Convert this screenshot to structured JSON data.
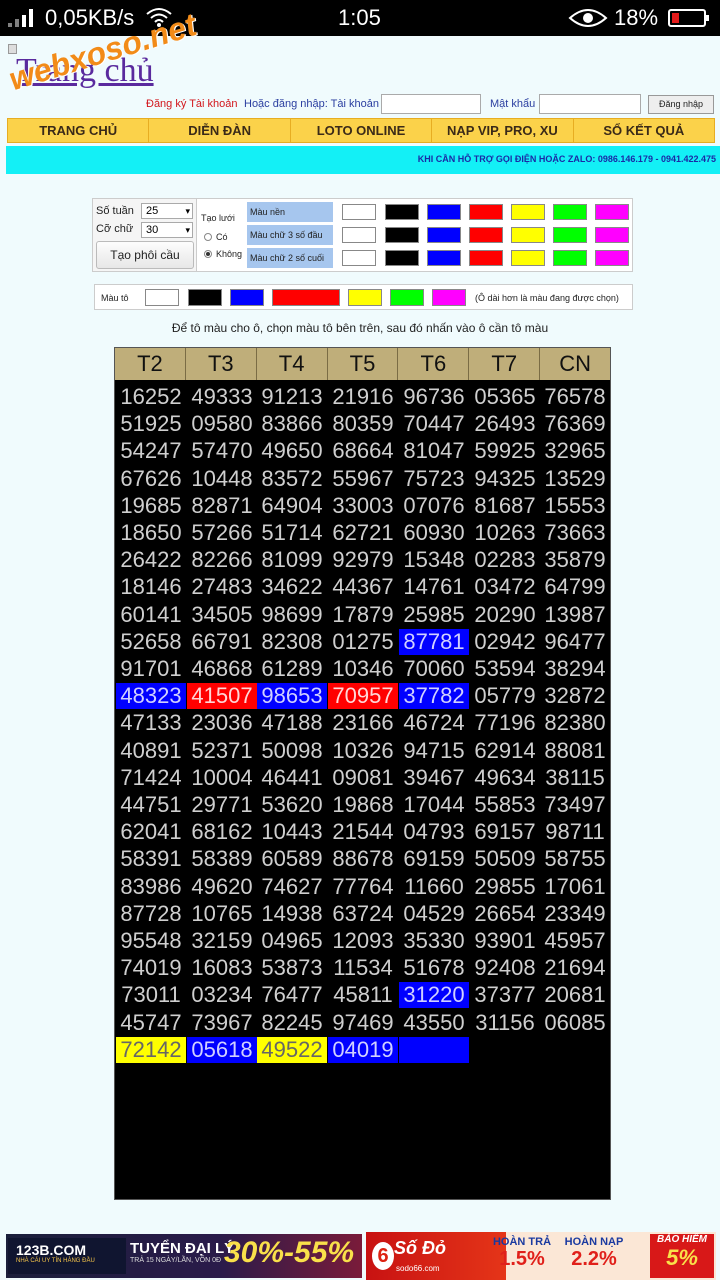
{
  "status_bar": {
    "speed": "0,05KB/s",
    "time": "1:05",
    "battery": "18%"
  },
  "header": {
    "logo_link": "Trang chủ",
    "watermark": "webxoso.net",
    "register": "Đăng ký Tài khoản",
    "login_label": "Hoặc đăng nhập: Tài khoản",
    "password_label": "Mật khẩu",
    "login_button": "Đăng nhập"
  },
  "nav": [
    "TRANG CHỦ",
    "DIỄN ĐÀN",
    "LOTO ONLINE",
    "NẠP VIP, PRO, XU",
    "SỔ KẾT QUẢ"
  ],
  "hotline": "KHI CẦN HỖ TRỢ GỌI ĐIỆN HOẶC ZALO: 0986.146.179 - 0941.422.475",
  "tool": {
    "weeks_label": "Số tuần",
    "weeks_value": "25",
    "font_label": "Cỡ chữ",
    "font_value": "30",
    "create_button": "Tạo phôi cầu",
    "grid_label": "Tạo lưới",
    "opt_yes": "Có",
    "opt_no": "Không",
    "row_labels": [
      "Màu nền",
      "Màu chữ 3 số đầu",
      "Màu chữ 2 số cuối"
    ],
    "palette": [
      "#ffffff",
      "#000000",
      "#0000ff",
      "#ff0000",
      "#ffff00",
      "#00ff00",
      "#ff00ff"
    ],
    "paint_label": "Màu tô",
    "paint_note": "(Ô dài hơn là màu đang được chọn)"
  },
  "instruction": "Để tô màu cho ô, chọn màu tô bên trên, sau đó nhấn vào ô cần tô màu",
  "grid": {
    "headers": [
      "T2",
      "T3",
      "T4",
      "T5",
      "T6",
      "T7",
      "CN"
    ],
    "rows": [
      [
        "16252",
        "49333",
        "91213",
        "21916",
        "96736",
        "05365",
        "76578"
      ],
      [
        "51925",
        "09580",
        "83866",
        "80359",
        "70447",
        "26493",
        "76369"
      ],
      [
        "54247",
        "57470",
        "49650",
        "68664",
        "81047",
        "59925",
        "32965"
      ],
      [
        "67626",
        "10448",
        "83572",
        "55967",
        "75723",
        "94325",
        "13529"
      ],
      [
        "19685",
        "82871",
        "64904",
        "33003",
        "07076",
        "81687",
        "15553"
      ],
      [
        "18650",
        "57266",
        "51714",
        "62721",
        "60930",
        "10263",
        "73663"
      ],
      [
        "26422",
        "82266",
        "81099",
        "92979",
        "15348",
        "02283",
        "35879"
      ],
      [
        "18146",
        "27483",
        "34622",
        "44367",
        "14761",
        "03472",
        "64799"
      ],
      [
        "60141",
        "34505",
        "98699",
        "17879",
        "25985",
        "20290",
        "13987"
      ],
      [
        "52658",
        "66791",
        "82308",
        "01275",
        "87781",
        "02942",
        "96477"
      ],
      [
        "91701",
        "46868",
        "61289",
        "10346",
        "70060",
        "53594",
        "38294"
      ],
      [
        "48323",
        "41507",
        "98653",
        "70957",
        "37782",
        "05779",
        "32872"
      ],
      [
        "47133",
        "23036",
        "47188",
        "23166",
        "46724",
        "77196",
        "82380"
      ],
      [
        "40891",
        "52371",
        "50098",
        "10326",
        "94715",
        "62914",
        "88081"
      ],
      [
        "71424",
        "10004",
        "46441",
        "09081",
        "39467",
        "49634",
        "38115"
      ],
      [
        "44751",
        "29771",
        "53620",
        "19868",
        "17044",
        "55853",
        "73497"
      ],
      [
        "62041",
        "68162",
        "10443",
        "21544",
        "04793",
        "69157",
        "98711"
      ],
      [
        "58391",
        "58389",
        "60589",
        "88678",
        "69159",
        "50509",
        "58755"
      ],
      [
        "83986",
        "49620",
        "74627",
        "77764",
        "11660",
        "29855",
        "17061"
      ],
      [
        "87728",
        "10765",
        "14938",
        "63724",
        "04529",
        "26654",
        "23349"
      ],
      [
        "95548",
        "32159",
        "04965",
        "12093",
        "35330",
        "93901",
        "45957"
      ],
      [
        "74019",
        "16083",
        "53873",
        "11534",
        "51678",
        "92408",
        "21694"
      ],
      [
        "73011",
        "03234",
        "76477",
        "45811",
        "31220",
        "37377",
        "20681"
      ],
      [
        "45747",
        "73967",
        "82245",
        "97469",
        "43550",
        "31156",
        "06085"
      ],
      [
        "72142",
        "05618",
        "49522",
        "04019",
        "",
        "",
        ""
      ]
    ],
    "highlights": [
      {
        "row": 9,
        "col": 4,
        "bg": "#0000ff",
        "fg": "#d0d0ff"
      },
      {
        "row": 11,
        "col": 0,
        "bg": "#0000ff",
        "fg": "#d0d0ff"
      },
      {
        "row": 11,
        "col": 1,
        "bg": "#ff0000",
        "fg": "#ffd6d6"
      },
      {
        "row": 11,
        "col": 2,
        "bg": "#0000ff",
        "fg": "#d0d0ff"
      },
      {
        "row": 11,
        "col": 3,
        "bg": "#ff0000",
        "fg": "#ffd6d6"
      },
      {
        "row": 11,
        "col": 4,
        "bg": "#0000ff",
        "fg": "#d0d0ff"
      },
      {
        "row": 22,
        "col": 4,
        "bg": "#0000ff",
        "fg": "#d0d0ff"
      },
      {
        "row": 24,
        "col": 0,
        "bg": "#ffff00",
        "fg": "#666666"
      },
      {
        "row": 24,
        "col": 1,
        "bg": "#0000ff",
        "fg": "#d0d0ff"
      },
      {
        "row": 24,
        "col": 2,
        "bg": "#ffff00",
        "fg": "#666666"
      },
      {
        "row": 24,
        "col": 3,
        "bg": "#0000ff",
        "fg": "#d0d0ff"
      },
      {
        "row": 24,
        "col": 4,
        "bg": "#0000ff",
        "fg": "#d0d0ff"
      }
    ]
  },
  "ads": {
    "ad1_brand": "123B.COM",
    "ad1_tagline": "NHÀ CÁI UY TÍN HÀNG ĐẦU",
    "ad1_title": "TUYỂN ĐẠI LÝ",
    "ad1_sub": "TRẢ 15 NGÀY/LẦN, VỐN 0Đ",
    "ad1_pct": "30%-55%",
    "ad2_brand": "Số Đỏ",
    "ad2_url": "sodo66.com",
    "ad2_six": "6",
    "ad2_b1_label": "HOÀN TRẢ",
    "ad2_b1_value": "1.5%",
    "ad2_b2_label": "HOÀN NẠP",
    "ad2_b2_value": "2.2%",
    "ad2_b3_label": "BẢO HIỂM",
    "ad2_b3_value": "5%"
  }
}
